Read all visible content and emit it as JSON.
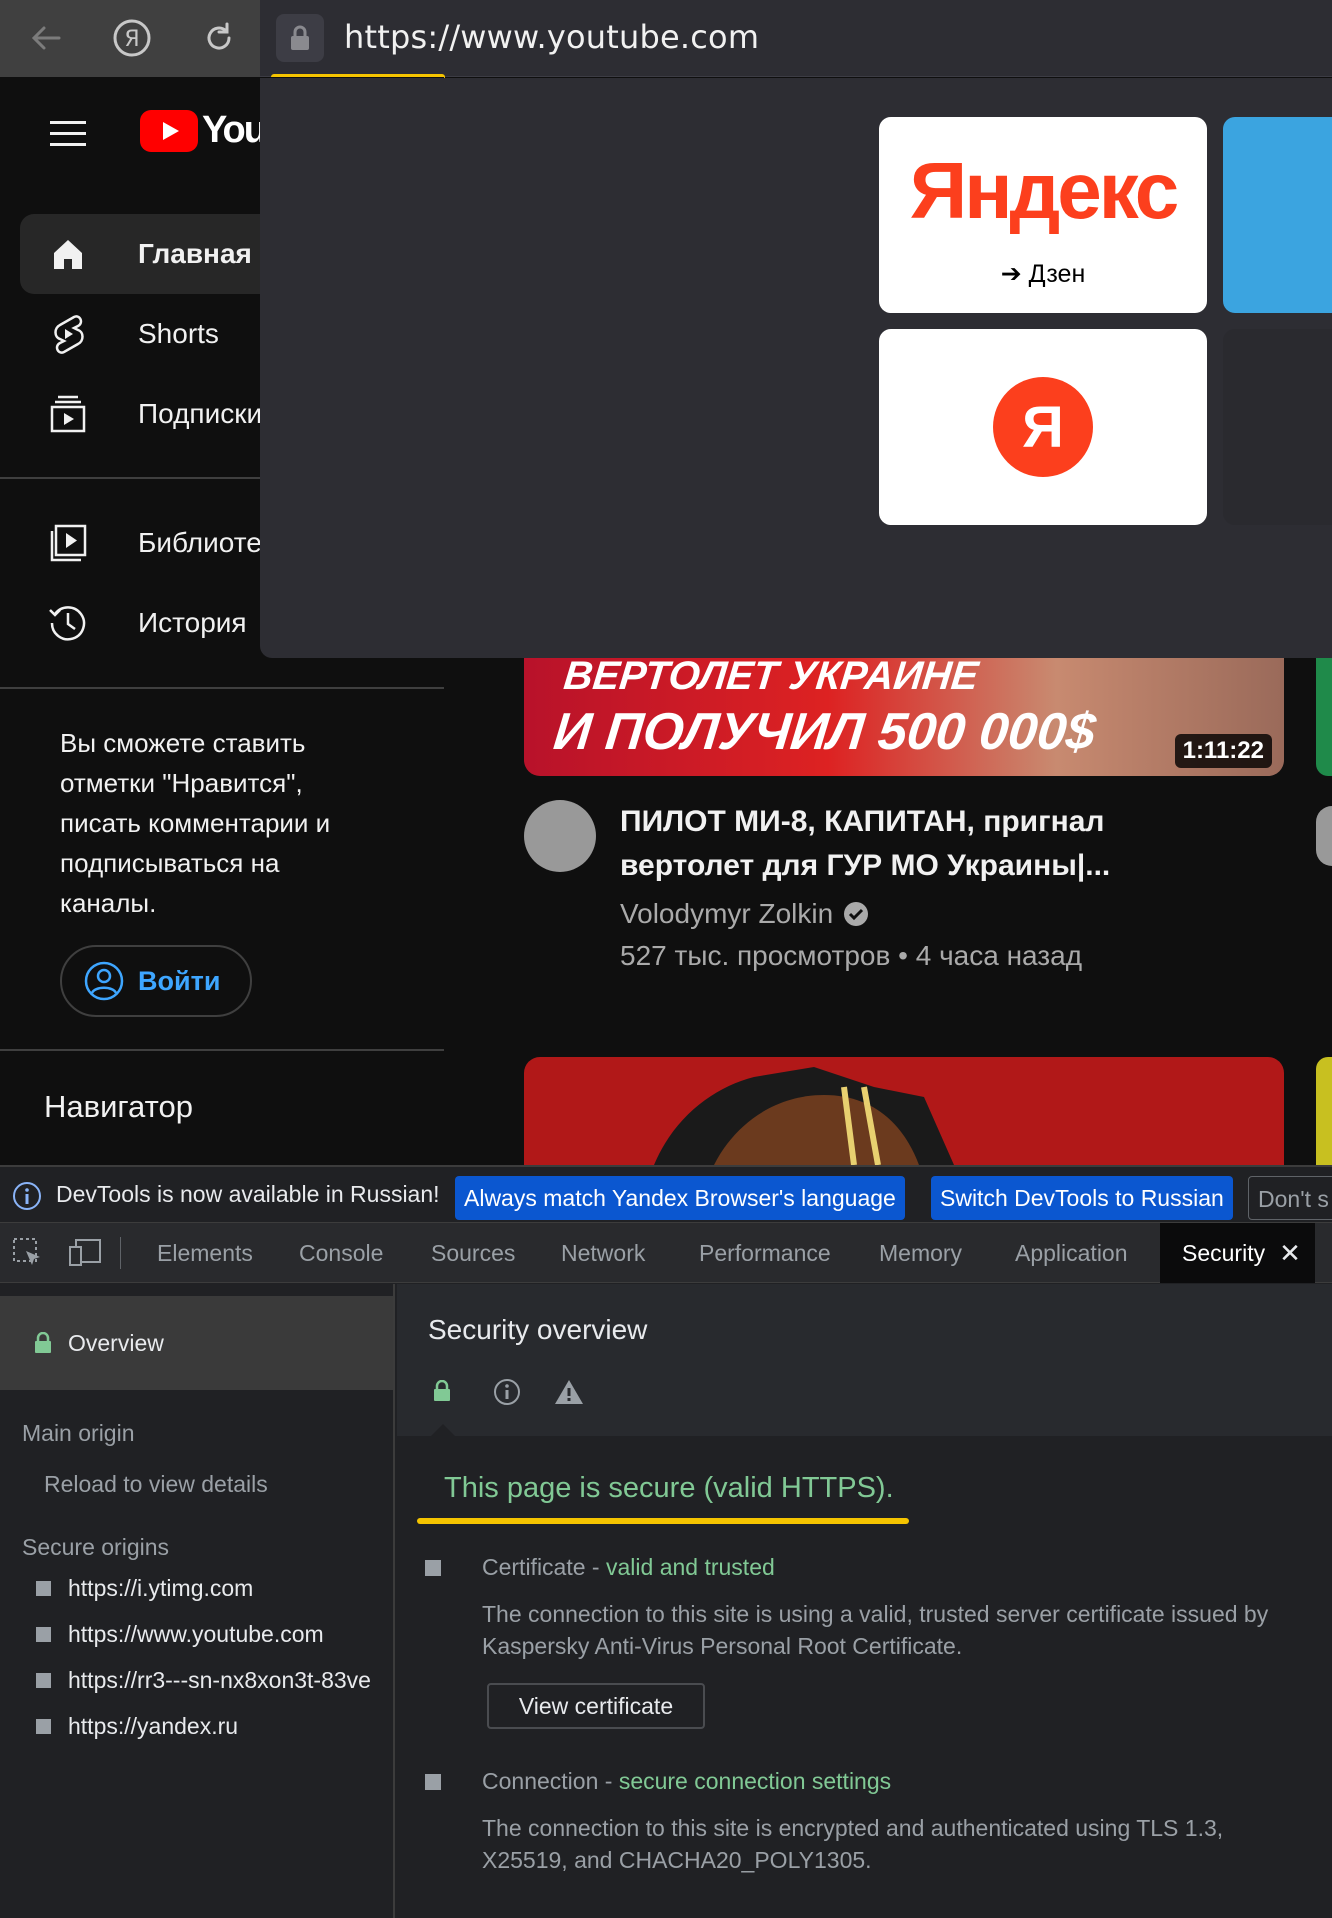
{
  "browser": {
    "url": "https://www.youtube.com",
    "tiles": [
      {
        "logo_text": "Яндекс",
        "caption": "➔ Дзен"
      },
      {
        "logo_text": "Я"
      }
    ]
  },
  "youtube": {
    "logo_text": "YouT",
    "sidebar": {
      "items": [
        {
          "label": "Главная"
        },
        {
          "label": "Shorts"
        },
        {
          "label": "Подписки"
        },
        {
          "label": "Библиотека"
        },
        {
          "label": "История"
        }
      ],
      "signin_prompt": "Вы сможете ставить отметки \"Нравится\", писать комментарии и подписываться на каналы.",
      "signin_button": "Войти",
      "navigator_heading": "Навигатор"
    },
    "video": {
      "thumb_line1": "ВЕРТОЛЕТ УКРАИНЕ",
      "thumb_line2": "И ПОЛУЧИЛ 500 000$",
      "duration": "1:11:22",
      "title": "ПИЛОТ МИ-8, КАПИТАН, пригнал вертолет для ГУР МО Украины|...",
      "channel": "Volodymyr Zolkin",
      "meta": "527 тыс. просмотров • 4 часа назад"
    }
  },
  "devtools": {
    "banner": {
      "message": "DevTools is now available in Russian!",
      "btn_match": "Always match Yandex Browser's language",
      "btn_switch": "Switch DevTools to Russian",
      "btn_dont": "Don't s"
    },
    "tabs": [
      "Elements",
      "Console",
      "Sources",
      "Network",
      "Performance",
      "Memory",
      "Application",
      "Security"
    ],
    "active_tab": "Security",
    "sidebar": {
      "overview": "Overview",
      "main_origin_heading": "Main origin",
      "main_origin_detail": "Reload to view details",
      "secure_origins_heading": "Secure origins",
      "secure_origins": [
        "https://i.ytimg.com",
        "https://www.youtube.com",
        "https://rr3---sn-nx8xon3t-83ve",
        "https://yandex.ru"
      ]
    },
    "security": {
      "title": "Security overview",
      "summary": "This page is secure (valid HTTPS).",
      "certificate_label": "Certificate",
      "certificate_status": "valid and trusted",
      "certificate_desc": "The connection to this site is using a valid, trusted server certificate issued by Kaspersky Anti-Virus Personal Root Certificate.",
      "view_certificate": "View certificate",
      "connection_label": "Connection",
      "connection_status": "secure connection settings",
      "connection_desc": "The connection to this site is encrypted and authenticated using TLS 1.3, X25519, and CHACHA20_POLY1305."
    }
  },
  "colors": {
    "accent_yellow": "#f5c400",
    "secure_green": "#81c995",
    "banner_blue": "#0b57d0",
    "youtube_red": "#ff0000"
  }
}
